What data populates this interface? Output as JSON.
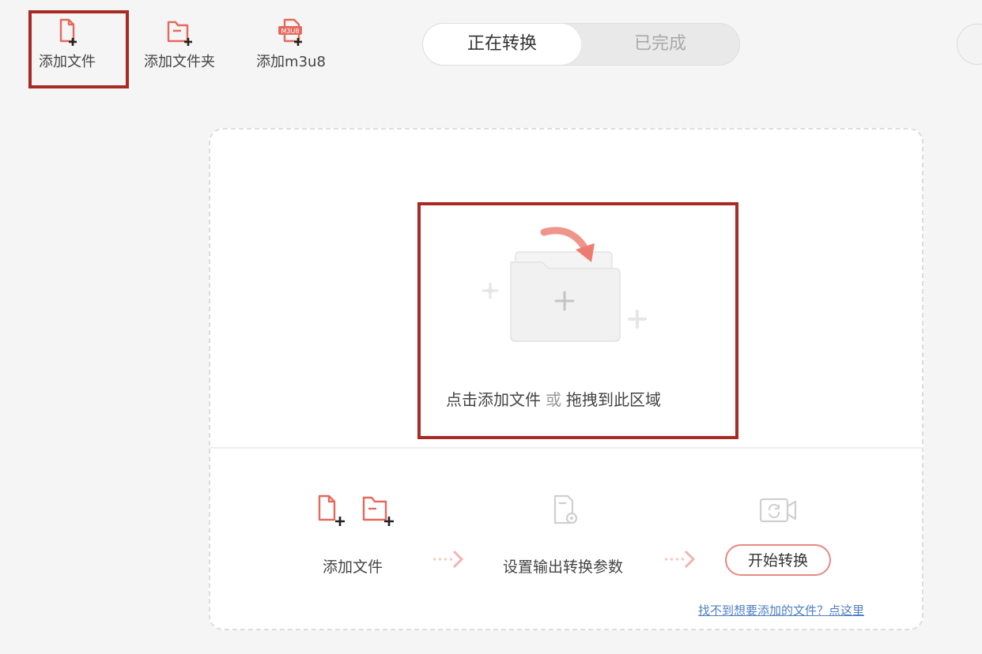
{
  "toolbar": {
    "add_file": {
      "label": "添加文件",
      "icon": "file-add-icon"
    },
    "add_folder": {
      "label": "添加文件夹",
      "icon": "folder-add-icon"
    },
    "add_m3u8": {
      "label": "添加m3u8",
      "icon": "m3u8-add-icon",
      "badge": "M3U8"
    }
  },
  "tabs": [
    {
      "label": "正在转换",
      "active": true
    },
    {
      "label": "已完成",
      "active": false
    }
  ],
  "drop_zone": {
    "text_click": "点击添加文件",
    "text_or": "或",
    "text_drag": "拖拽到此区域"
  },
  "steps": {
    "add_files": "添加文件",
    "set_params": "设置输出转换参数",
    "start_button": "开始转换"
  },
  "help_link": "找不到想要添加的文件？点这里",
  "colors": {
    "accent": "#e36a5d",
    "highlight_border": "#a82a24",
    "link": "#4f7fc0"
  }
}
